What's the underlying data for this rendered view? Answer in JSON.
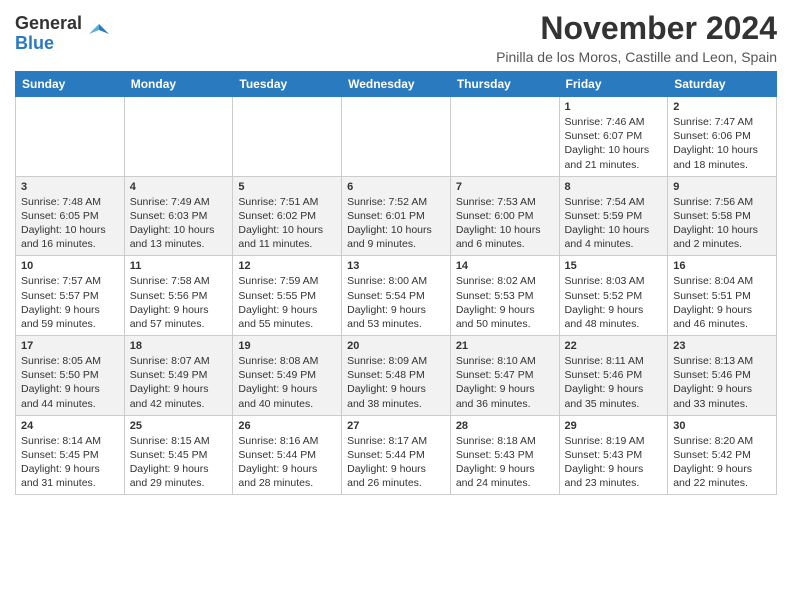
{
  "logo": {
    "general": "General",
    "blue": "Blue"
  },
  "title": {
    "month_year": "November 2024",
    "location": "Pinilla de los Moros, Castille and Leon, Spain"
  },
  "weekdays": [
    "Sunday",
    "Monday",
    "Tuesday",
    "Wednesday",
    "Thursday",
    "Friday",
    "Saturday"
  ],
  "weeks": [
    [
      {
        "day": "",
        "info": ""
      },
      {
        "day": "",
        "info": ""
      },
      {
        "day": "",
        "info": ""
      },
      {
        "day": "",
        "info": ""
      },
      {
        "day": "",
        "info": ""
      },
      {
        "day": "1",
        "info": "Sunrise: 7:46 AM\nSunset: 6:07 PM\nDaylight: 10 hours and 21 minutes."
      },
      {
        "day": "2",
        "info": "Sunrise: 7:47 AM\nSunset: 6:06 PM\nDaylight: 10 hours and 18 minutes."
      }
    ],
    [
      {
        "day": "3",
        "info": "Sunrise: 7:48 AM\nSunset: 6:05 PM\nDaylight: 10 hours and 16 minutes."
      },
      {
        "day": "4",
        "info": "Sunrise: 7:49 AM\nSunset: 6:03 PM\nDaylight: 10 hours and 13 minutes."
      },
      {
        "day": "5",
        "info": "Sunrise: 7:51 AM\nSunset: 6:02 PM\nDaylight: 10 hours and 11 minutes."
      },
      {
        "day": "6",
        "info": "Sunrise: 7:52 AM\nSunset: 6:01 PM\nDaylight: 10 hours and 9 minutes."
      },
      {
        "day": "7",
        "info": "Sunrise: 7:53 AM\nSunset: 6:00 PM\nDaylight: 10 hours and 6 minutes."
      },
      {
        "day": "8",
        "info": "Sunrise: 7:54 AM\nSunset: 5:59 PM\nDaylight: 10 hours and 4 minutes."
      },
      {
        "day": "9",
        "info": "Sunrise: 7:56 AM\nSunset: 5:58 PM\nDaylight: 10 hours and 2 minutes."
      }
    ],
    [
      {
        "day": "10",
        "info": "Sunrise: 7:57 AM\nSunset: 5:57 PM\nDaylight: 9 hours and 59 minutes."
      },
      {
        "day": "11",
        "info": "Sunrise: 7:58 AM\nSunset: 5:56 PM\nDaylight: 9 hours and 57 minutes."
      },
      {
        "day": "12",
        "info": "Sunrise: 7:59 AM\nSunset: 5:55 PM\nDaylight: 9 hours and 55 minutes."
      },
      {
        "day": "13",
        "info": "Sunrise: 8:00 AM\nSunset: 5:54 PM\nDaylight: 9 hours and 53 minutes."
      },
      {
        "day": "14",
        "info": "Sunrise: 8:02 AM\nSunset: 5:53 PM\nDaylight: 9 hours and 50 minutes."
      },
      {
        "day": "15",
        "info": "Sunrise: 8:03 AM\nSunset: 5:52 PM\nDaylight: 9 hours and 48 minutes."
      },
      {
        "day": "16",
        "info": "Sunrise: 8:04 AM\nSunset: 5:51 PM\nDaylight: 9 hours and 46 minutes."
      }
    ],
    [
      {
        "day": "17",
        "info": "Sunrise: 8:05 AM\nSunset: 5:50 PM\nDaylight: 9 hours and 44 minutes."
      },
      {
        "day": "18",
        "info": "Sunrise: 8:07 AM\nSunset: 5:49 PM\nDaylight: 9 hours and 42 minutes."
      },
      {
        "day": "19",
        "info": "Sunrise: 8:08 AM\nSunset: 5:49 PM\nDaylight: 9 hours and 40 minutes."
      },
      {
        "day": "20",
        "info": "Sunrise: 8:09 AM\nSunset: 5:48 PM\nDaylight: 9 hours and 38 minutes."
      },
      {
        "day": "21",
        "info": "Sunrise: 8:10 AM\nSunset: 5:47 PM\nDaylight: 9 hours and 36 minutes."
      },
      {
        "day": "22",
        "info": "Sunrise: 8:11 AM\nSunset: 5:46 PM\nDaylight: 9 hours and 35 minutes."
      },
      {
        "day": "23",
        "info": "Sunrise: 8:13 AM\nSunset: 5:46 PM\nDaylight: 9 hours and 33 minutes."
      }
    ],
    [
      {
        "day": "24",
        "info": "Sunrise: 8:14 AM\nSunset: 5:45 PM\nDaylight: 9 hours and 31 minutes."
      },
      {
        "day": "25",
        "info": "Sunrise: 8:15 AM\nSunset: 5:45 PM\nDaylight: 9 hours and 29 minutes."
      },
      {
        "day": "26",
        "info": "Sunrise: 8:16 AM\nSunset: 5:44 PM\nDaylight: 9 hours and 28 minutes."
      },
      {
        "day": "27",
        "info": "Sunrise: 8:17 AM\nSunset: 5:44 PM\nDaylight: 9 hours and 26 minutes."
      },
      {
        "day": "28",
        "info": "Sunrise: 8:18 AM\nSunset: 5:43 PM\nDaylight: 9 hours and 24 minutes."
      },
      {
        "day": "29",
        "info": "Sunrise: 8:19 AM\nSunset: 5:43 PM\nDaylight: 9 hours and 23 minutes."
      },
      {
        "day": "30",
        "info": "Sunrise: 8:20 AM\nSunset: 5:42 PM\nDaylight: 9 hours and 22 minutes."
      }
    ]
  ]
}
